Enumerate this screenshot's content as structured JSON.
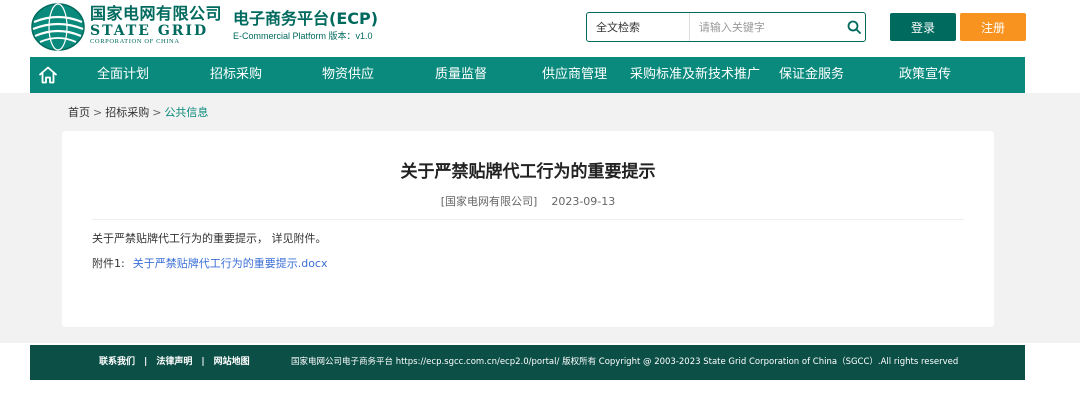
{
  "logo": {
    "cn": "国家电网有限公司",
    "en": "STATE GRID",
    "en_sub": "CORPORATION OF CHINA",
    "brand_color": "#006a5e"
  },
  "platform": {
    "title": "电子商务平台(ECP)",
    "subtitle": "E-Commercial Platform 版本：v1.0"
  },
  "search": {
    "scope": "全文检索",
    "placeholder": "请输入关键字",
    "icon": "search-icon"
  },
  "auth": {
    "login_label": "登录",
    "register_label": "注册",
    "login_color": "#006a5e",
    "register_color": "#f7931e"
  },
  "nav": {
    "home_icon": "home-icon",
    "items": [
      "全面计划",
      "招标采购",
      "物资供应",
      "质量监督",
      "供应商管理",
      "采购标准及新技术推广",
      "保证金服务",
      "政策宣传"
    ],
    "color": "#0a8a7c"
  },
  "breadcrumb": {
    "home": "首页",
    "level1": "招标采购",
    "current": "公共信息",
    "separator": ">"
  },
  "article": {
    "title": "关于严禁贴牌代工行为的重要提示",
    "source": "[国家电网有限公司]",
    "date": "2023-09-13",
    "body": "关于严禁贴牌代工行为的重要提示， 详见附件。",
    "attachment_label": "附件1:",
    "attachment_link": "关于严禁贴牌代工行为的重要提示.docx"
  },
  "footer": {
    "links": [
      "联系我们",
      "法律声明",
      "网站地图"
    ],
    "separator": "|",
    "copyright": "国家电网公司电子商务平台 https://ecp.sgcc.com.cn/ecp2.0/portal/ 版权所有 Copyright @ 2003-2023 State Grid Corporation of China（SGCC）.All rights reserved",
    "bg_color": "#0c4f47"
  }
}
